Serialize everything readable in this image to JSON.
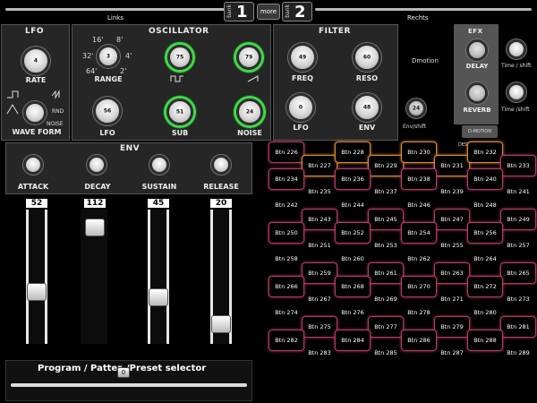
{
  "header": {
    "links_label": "Links",
    "rechts_label": "Rechts",
    "bank_prefix": "bank",
    "bank_left": "1",
    "bank_right": "2",
    "more_label": "more"
  },
  "lfo": {
    "title": "LFO",
    "rate_label": "RATE",
    "rate_value": "4",
    "rnd_label": "RND",
    "noise_label": "NOISE",
    "wave_label": "WAVE FORM"
  },
  "oscillator": {
    "title": "OSCILLATOR",
    "range_label": "RANGE",
    "range_ticks": [
      "16'",
      "8'",
      "32'",
      "4'",
      "64'",
      "2'"
    ],
    "range_value": "3",
    "knob1_value": "75",
    "knob2_value": "79",
    "lfo_label": "LFO",
    "lfo_value": "56",
    "sub_label": "SUB",
    "sub_value": "51",
    "noise_label": "NOISE",
    "noise_value": "24"
  },
  "filter": {
    "title": "FILTER",
    "freq_label": "FREQ",
    "freq_value": "49",
    "reso_label": "RESO",
    "reso_value": "60",
    "lfo_label": "LFO",
    "lfo_value": "0",
    "env_label": "ENV",
    "env_value": "48"
  },
  "dmotion": {
    "label": "Dmotion",
    "envshift_label": "Env/shift",
    "envshift_value": "24",
    "dest_label": "DESTINATION",
    "dm_button": "D-MOTION"
  },
  "efx": {
    "title": "EFX",
    "delay_label": "DELAY",
    "reverb_label": "REVERB",
    "time_shift_1": "Time / shift",
    "time_shift_2": "Time /shift"
  },
  "env": {
    "title": "ENV",
    "attack_label": "ATTACK",
    "decay_label": "DECAY",
    "sustain_label": "SUSTAIN",
    "release_label": "RELEASE",
    "attack_value": "52",
    "decay_value": "112",
    "sustain_value": "45",
    "release_value": "20"
  },
  "program": {
    "label": "Program / Patter",
    "preset_label": "/Preset selector",
    "value": "0"
  },
  "buttons": [
    "Btn 226",
    "Btn 227",
    "Btn 228",
    "Btn 229",
    "Btn 230",
    "Btn 231",
    "Btn 232",
    "Btn 233",
    "Btn 234",
    "Btn 235",
    "Btn 236",
    "Btn 237",
    "Btn 238",
    "Btn 239",
    "Btn 240",
    "Btn 241",
    "Btn 242",
    "Btn 243",
    "Btn 244",
    "Btn 245",
    "Btn 246",
    "Btn 247",
    "Btn 248",
    "Btn 249",
    "Btn 250",
    "Btn 251",
    "Btn 252",
    "Btn 253",
    "Btn 254",
    "Btn 255",
    "Btn 256",
    "Btn 257",
    "Btn 258",
    "Btn 259",
    "Btn 260",
    "Btn 261",
    "Btn 262",
    "Btn 263",
    "Btn 264",
    "Btn 265",
    "Btn 266",
    "Btn 267",
    "Btn 268",
    "Btn 269",
    "Btn 270",
    "Btn 271",
    "Btn 272",
    "Btn 273",
    "Btn 274",
    "Btn 275",
    "Btn 276",
    "Btn 277",
    "Btn 278",
    "Btn 279",
    "Btn 280",
    "Btn 281",
    "Btn 282",
    "Btn 283",
    "Btn 284",
    "Btn 285",
    "Btn 286",
    "Btn 287",
    "Btn 288",
    "Btn 289"
  ],
  "colors": {
    "accent_green": "#42d84a",
    "button_border": "#b33a6a",
    "button_border_orange": "#d88a3a"
  }
}
